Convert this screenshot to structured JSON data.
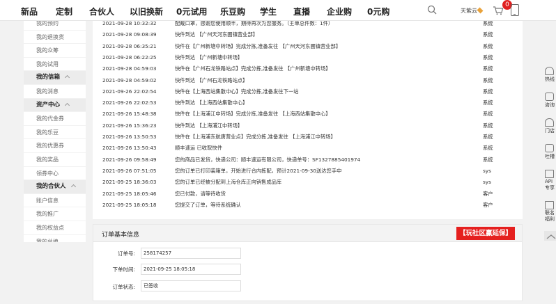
{
  "nav": {
    "items": [
      "新品",
      "定制",
      "合伙人",
      "以旧换新",
      "0元试用",
      "乐豆购",
      "学生",
      "直播",
      "企业购",
      "0元购"
    ],
    "user_name": "天紫云",
    "cart_count": "0"
  },
  "sidebar": {
    "items": [
      {
        "label": "我的预约",
        "head": false
      },
      {
        "label": "我的退换货",
        "head": false
      },
      {
        "label": "我的众筹",
        "head": false
      },
      {
        "label": "我的试用",
        "head": false
      },
      {
        "label": "我的信箱",
        "head": true
      },
      {
        "label": "我的消息",
        "head": false
      },
      {
        "label": "资产中心",
        "head": true
      },
      {
        "label": "我的代金券",
        "head": false
      },
      {
        "label": "我的乐豆",
        "head": false
      },
      {
        "label": "我的优惠券",
        "head": false
      },
      {
        "label": "我的奖品",
        "head": false
      },
      {
        "label": "领券中心",
        "head": false
      },
      {
        "label": "我的合伙人",
        "head": true
      },
      {
        "label": "账户信息",
        "head": false
      },
      {
        "label": "我的推广",
        "head": false
      },
      {
        "label": "我的权益点",
        "head": false
      },
      {
        "label": "我的兑换",
        "head": false
      }
    ]
  },
  "logistics": {
    "rows": [
      {
        "time": "2021-09-28 10:32:32",
        "msg": "配戴口罩，感谢您使用顺丰，期待再次为您服务。（主单总件数：1件）",
        "op": "系统"
      },
      {
        "time": "2021-09-28 09:08:39",
        "msg": "快件到达 【广州天河东圃镇营业部】",
        "op": "系统"
      },
      {
        "time": "2021-09-28 06:35:21",
        "msg": "快件在【广州新塘中转场】完成分拣,准备发往 【广州天河东圃镇营业部】",
        "op": "系统"
      },
      {
        "time": "2021-09-28 06:22:25",
        "msg": "快件到达 【广州新塘中转场】",
        "op": "系统"
      },
      {
        "time": "2021-09-28 04:59:03",
        "msg": "快件在【广州石龙铁路站点】完成分拣,准备发往 【广州新塘中转场】",
        "op": "系统"
      },
      {
        "time": "2021-09-28 04:59:02",
        "msg": "快件到达 【广州石龙铁路站点】",
        "op": "系统"
      },
      {
        "time": "2021-09-26 22:02:54",
        "msg": "快件在【上海西站集散中心】完成分拣,准备发往下一站",
        "op": "系统"
      },
      {
        "time": "2021-09-26 22:02:53",
        "msg": "快件到达 【上海西站集散中心】",
        "op": "系统"
      },
      {
        "time": "2021-09-26 15:48:38",
        "msg": "快件在【上海浦江中转场】完成分拣,准备发往 【上海西站集散中心】",
        "op": "系统"
      },
      {
        "time": "2021-09-26 15:36:23",
        "msg": "快件到达 【上海浦江中转场】",
        "op": "系统"
      },
      {
        "time": "2021-09-26 13:50:53",
        "msg": "快件在【上海浦东航唐营业点】完成分拣,准备发往 【上海浦江中转场】",
        "op": "系统"
      },
      {
        "time": "2021-09-26 13:50:43",
        "msg": "顺丰速运 已收取快件",
        "op": "系统"
      },
      {
        "time": "2021-09-26 09:58:49",
        "msg": "您的商品已发货，快递公司：顺丰速运有限公司，快递单号：SF1327885401974",
        "op": "系统"
      },
      {
        "time": "2021-09-26 07:51:05",
        "msg": "您的订单已打印装箱单，开始进行合内拣配，预计2021-09-30送达您手中",
        "op": "sys"
      },
      {
        "time": "2021-09-25 18:36:03",
        "msg": "您的订单已经被分配到上海仓库正向销售成品库",
        "op": "sys"
      },
      {
        "time": "2021-09-25 18:05:46",
        "msg": "您已付款，请等待收货",
        "op": "客户"
      },
      {
        "time": "2021-09-25 18:05:18",
        "msg": "您提交了订单，等待系统确认",
        "op": "客户"
      }
    ]
  },
  "order_info": {
    "title": "订单基本信息",
    "promo": "【玩社区赢延保】",
    "fields": [
      {
        "label": "订单号:",
        "value": "258174257"
      },
      {
        "label": "下单时间:",
        "value": "2021-09-25 18:05:18"
      },
      {
        "label": "订单状态:",
        "value": "已签收"
      }
    ]
  },
  "right_bar": {
    "items": [
      "热线",
      "咨询",
      "门店",
      "吐槽",
      "API专享",
      "联名福利"
    ]
  }
}
